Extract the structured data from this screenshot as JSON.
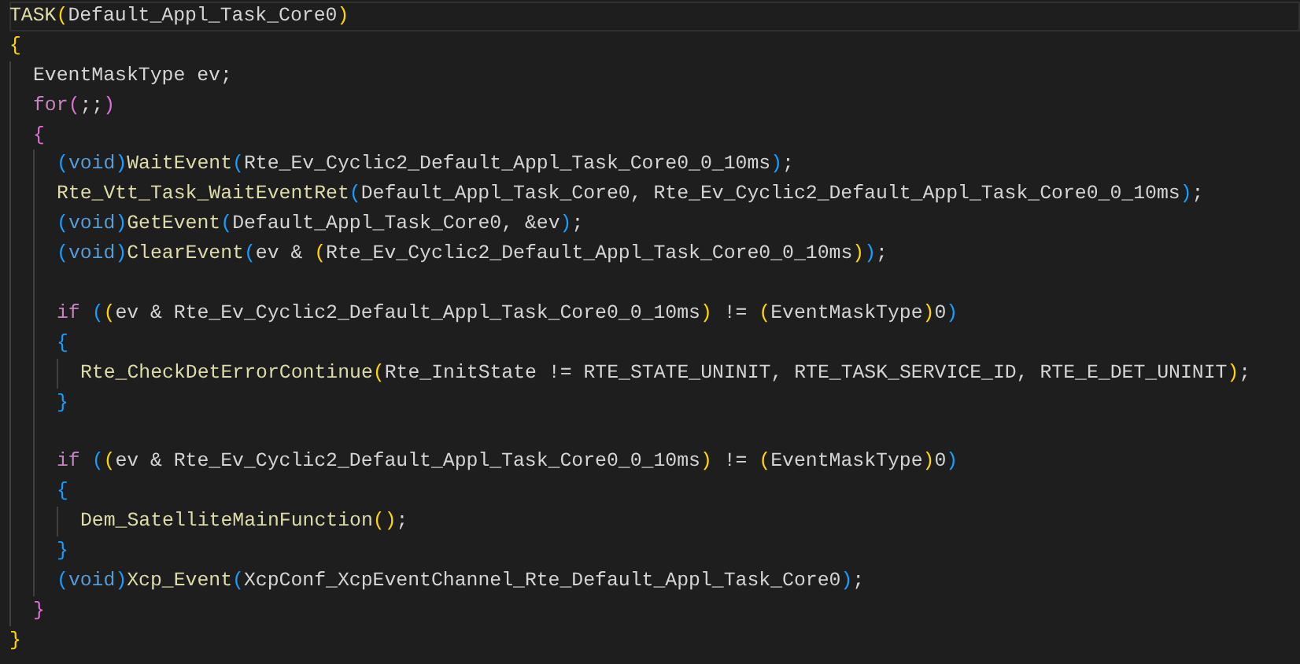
{
  "editor": {
    "lines": [
      {
        "tokens": [
          {
            "kind": "func",
            "text": "TASK"
          },
          {
            "kind": "bracket",
            "text": "(",
            "color": "#ffd700"
          },
          {
            "kind": "plain",
            "text": "Default_Appl_Task_Core0"
          },
          {
            "kind": "bracket",
            "text": ")",
            "color": "#ffd700"
          }
        ]
      },
      {
        "tokens": [
          {
            "kind": "bracket",
            "text": "{",
            "color": "#ffd700"
          }
        ]
      },
      {
        "kind": "block",
        "children": [
          {
            "tokens": [
              {
                "kind": "plain",
                "text": "EventMaskType ev;"
              }
            ]
          },
          {
            "tokens": [
              {
                "kind": "control",
                "text": "for"
              },
              {
                "kind": "bracket",
                "text": "(",
                "color": "#da70d6"
              },
              {
                "kind": "plain",
                "text": ";;"
              },
              {
                "kind": "bracket",
                "text": ")",
                "color": "#da70d6"
              }
            ]
          },
          {
            "tokens": [
              {
                "kind": "bracket",
                "text": "{",
                "color": "#da70d6"
              }
            ]
          },
          {
            "kind": "block",
            "children": [
              {
                "tokens": [
                  {
                    "kind": "bracket",
                    "text": "(",
                    "color": "#179fff"
                  },
                  {
                    "kind": "type",
                    "text": "void"
                  },
                  {
                    "kind": "bracket",
                    "text": ")",
                    "color": "#179fff"
                  },
                  {
                    "kind": "func",
                    "text": "WaitEvent"
                  },
                  {
                    "kind": "bracket",
                    "text": "(",
                    "color": "#179fff"
                  },
                  {
                    "kind": "plain",
                    "text": "Rte_Ev_Cyclic2_Default_Appl_Task_Core0_0_10ms"
                  },
                  {
                    "kind": "bracket",
                    "text": ")",
                    "color": "#179fff"
                  },
                  {
                    "kind": "plain",
                    "text": ";"
                  }
                ]
              },
              {
                "tokens": [
                  {
                    "kind": "func",
                    "text": "Rte_Vtt_Task_WaitEventRet"
                  },
                  {
                    "kind": "bracket",
                    "text": "(",
                    "color": "#179fff"
                  },
                  {
                    "kind": "plain",
                    "text": "Default_Appl_Task_Core0, Rte_Ev_Cyclic2_Default_Appl_Task_Core0_0_10ms"
                  },
                  {
                    "kind": "bracket",
                    "text": ")",
                    "color": "#179fff"
                  },
                  {
                    "kind": "plain",
                    "text": ";"
                  }
                ]
              },
              {
                "tokens": [
                  {
                    "kind": "bracket",
                    "text": "(",
                    "color": "#179fff"
                  },
                  {
                    "kind": "type",
                    "text": "void"
                  },
                  {
                    "kind": "bracket",
                    "text": ")",
                    "color": "#179fff"
                  },
                  {
                    "kind": "func",
                    "text": "GetEvent"
                  },
                  {
                    "kind": "bracket",
                    "text": "(",
                    "color": "#179fff"
                  },
                  {
                    "kind": "plain",
                    "text": "Default_Appl_Task_Core0, &ev"
                  },
                  {
                    "kind": "bracket",
                    "text": ")",
                    "color": "#179fff"
                  },
                  {
                    "kind": "plain",
                    "text": ";"
                  }
                ]
              },
              {
                "tokens": [
                  {
                    "kind": "bracket",
                    "text": "(",
                    "color": "#179fff"
                  },
                  {
                    "kind": "type",
                    "text": "void"
                  },
                  {
                    "kind": "bracket",
                    "text": ")",
                    "color": "#179fff"
                  },
                  {
                    "kind": "func",
                    "text": "ClearEvent"
                  },
                  {
                    "kind": "bracket",
                    "text": "(",
                    "color": "#179fff"
                  },
                  {
                    "kind": "plain",
                    "text": "ev & "
                  },
                  {
                    "kind": "bracket",
                    "text": "(",
                    "color": "#ffd700"
                  },
                  {
                    "kind": "plain",
                    "text": "Rte_Ev_Cyclic2_Default_Appl_Task_Core0_0_10ms"
                  },
                  {
                    "kind": "bracket",
                    "text": ")",
                    "color": "#ffd700"
                  },
                  {
                    "kind": "bracket",
                    "text": ")",
                    "color": "#179fff"
                  },
                  {
                    "kind": "plain",
                    "text": ";"
                  }
                ]
              },
              {
                "kind": "blank"
              },
              {
                "tokens": [
                  {
                    "kind": "control",
                    "text": "if "
                  },
                  {
                    "kind": "bracket",
                    "text": "(",
                    "color": "#179fff"
                  },
                  {
                    "kind": "bracket",
                    "text": "(",
                    "color": "#ffd700"
                  },
                  {
                    "kind": "plain",
                    "text": "ev & Rte_Ev_Cyclic2_Default_Appl_Task_Core0_0_10ms"
                  },
                  {
                    "kind": "bracket",
                    "text": ")",
                    "color": "#ffd700"
                  },
                  {
                    "kind": "plain",
                    "text": " != "
                  },
                  {
                    "kind": "bracket",
                    "text": "(",
                    "color": "#ffd700"
                  },
                  {
                    "kind": "plain",
                    "text": "EventMaskType"
                  },
                  {
                    "kind": "bracket",
                    "text": ")",
                    "color": "#ffd700"
                  },
                  {
                    "kind": "plain",
                    "text": "0"
                  },
                  {
                    "kind": "bracket",
                    "text": ")",
                    "color": "#179fff"
                  }
                ]
              },
              {
                "tokens": [
                  {
                    "kind": "bracket",
                    "text": "{",
                    "color": "#179fff"
                  }
                ]
              },
              {
                "kind": "block",
                "children": [
                  {
                    "tokens": [
                      {
                        "kind": "func",
                        "text": "Rte_CheckDetErrorContinue"
                      },
                      {
                        "kind": "bracket",
                        "text": "(",
                        "color": "#ffd700"
                      },
                      {
                        "kind": "plain",
                        "text": "Rte_InitState != RTE_STATE_UNINIT, RTE_TASK_SERVICE_ID, RTE_E_DET_UNINIT"
                      },
                      {
                        "kind": "bracket",
                        "text": ")",
                        "color": "#ffd700"
                      },
                      {
                        "kind": "plain",
                        "text": ";"
                      }
                    ]
                  }
                ]
              },
              {
                "tokens": [
                  {
                    "kind": "bracket",
                    "text": "}",
                    "color": "#179fff"
                  }
                ]
              },
              {
                "kind": "blank"
              },
              {
                "tokens": [
                  {
                    "kind": "control",
                    "text": "if "
                  },
                  {
                    "kind": "bracket",
                    "text": "(",
                    "color": "#179fff"
                  },
                  {
                    "kind": "bracket",
                    "text": "(",
                    "color": "#ffd700"
                  },
                  {
                    "kind": "plain",
                    "text": "ev & Rte_Ev_Cyclic2_Default_Appl_Task_Core0_0_10ms"
                  },
                  {
                    "kind": "bracket",
                    "text": ")",
                    "color": "#ffd700"
                  },
                  {
                    "kind": "plain",
                    "text": " != "
                  },
                  {
                    "kind": "bracket",
                    "text": "(",
                    "color": "#ffd700"
                  },
                  {
                    "kind": "plain",
                    "text": "EventMaskType"
                  },
                  {
                    "kind": "bracket",
                    "text": ")",
                    "color": "#ffd700"
                  },
                  {
                    "kind": "plain",
                    "text": "0"
                  },
                  {
                    "kind": "bracket",
                    "text": ")",
                    "color": "#179fff"
                  }
                ]
              },
              {
                "tokens": [
                  {
                    "kind": "bracket",
                    "text": "{",
                    "color": "#179fff"
                  }
                ]
              },
              {
                "kind": "block",
                "children": [
                  {
                    "tokens": [
                      {
                        "kind": "func",
                        "text": "Dem_SatelliteMainFunction"
                      },
                      {
                        "kind": "bracket",
                        "text": "(",
                        "color": "#ffd700"
                      },
                      {
                        "kind": "bracket",
                        "text": ")",
                        "color": "#ffd700"
                      },
                      {
                        "kind": "plain",
                        "text": ";"
                      }
                    ]
                  }
                ]
              },
              {
                "tokens": [
                  {
                    "kind": "bracket",
                    "text": "}",
                    "color": "#179fff"
                  }
                ]
              },
              {
                "tokens": [
                  {
                    "kind": "bracket",
                    "text": "(",
                    "color": "#179fff"
                  },
                  {
                    "kind": "type",
                    "text": "void"
                  },
                  {
                    "kind": "bracket",
                    "text": ")",
                    "color": "#179fff"
                  },
                  {
                    "kind": "func",
                    "text": "Xcp_Event"
                  },
                  {
                    "kind": "bracket",
                    "text": "(",
                    "color": "#179fff"
                  },
                  {
                    "kind": "plain",
                    "text": "XcpConf_XcpEventChannel_Rte_Default_Appl_Task_Core0"
                  },
                  {
                    "kind": "bracket",
                    "text": ")",
                    "color": "#179fff"
                  },
                  {
                    "kind": "plain",
                    "text": ";"
                  }
                ]
              }
            ]
          },
          {
            "tokens": [
              {
                "kind": "bracket",
                "text": "}",
                "color": "#da70d6"
              }
            ]
          }
        ]
      },
      {
        "tokens": [
          {
            "kind": "bracket",
            "text": "}",
            "color": "#ffd700"
          }
        ]
      }
    ]
  }
}
